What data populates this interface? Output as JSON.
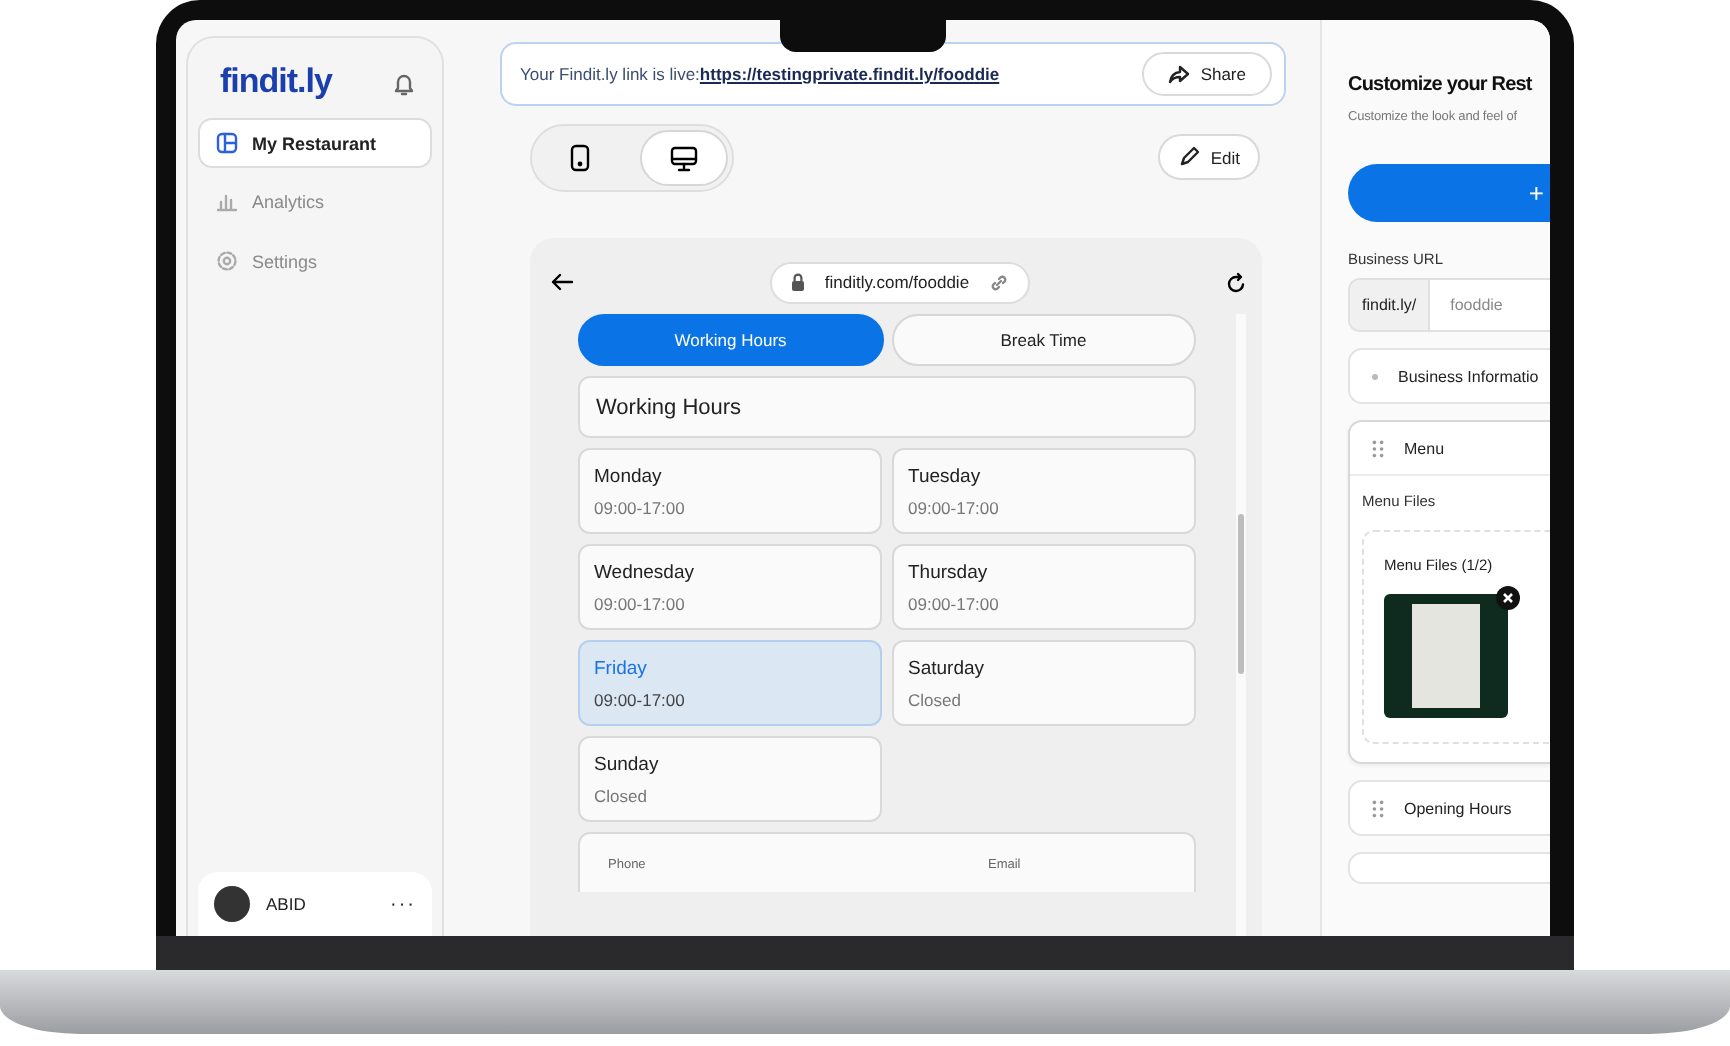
{
  "sidebar": {
    "logo": "findit.ly",
    "items": [
      {
        "label": "My Restaurant",
        "selected": true
      },
      {
        "label": "Analytics",
        "selected": false
      },
      {
        "label": "Settings",
        "selected": false
      }
    ],
    "user": {
      "name": "ABID",
      "more": "···"
    }
  },
  "banner": {
    "text": "Your Findit.ly link is live:",
    "link": "https://testingprivate.findit.ly/fooddie",
    "share": "Share"
  },
  "view_toggle": [
    {
      "kind": "mobile",
      "selected": false
    },
    {
      "kind": "desktop",
      "selected": true
    }
  ],
  "edit_button": "Edit",
  "preview": {
    "url": "finditly.com/fooddie",
    "tabs": [
      {
        "label": "Working Hours",
        "selected": true
      },
      {
        "label": "Break Time",
        "selected": false
      }
    ],
    "section_title": "Working Hours",
    "days": [
      {
        "day": "Monday",
        "hours": "09:00-17:00",
        "selected": false
      },
      {
        "day": "Tuesday",
        "hours": "09:00-17:00",
        "selected": false
      },
      {
        "day": "Wednesday",
        "hours": "09:00-17:00",
        "selected": false
      },
      {
        "day": "Thursday",
        "hours": "09:00-17:00",
        "selected": false
      },
      {
        "day": "Friday",
        "hours": "09:00-17:00",
        "selected": true
      },
      {
        "day": "Saturday",
        "hours": "Closed",
        "selected": false
      },
      {
        "day": "Sunday",
        "hours": "Closed",
        "selected": false
      }
    ],
    "contact_labels": [
      "Phone",
      "Email"
    ]
  },
  "panel": {
    "title": "Customize your Rest",
    "subtitle": "Customize the look and feel of",
    "add_button": "+",
    "url_label": "Business URL",
    "url_prefix": "findit.ly/",
    "url_value": "fooddie",
    "sections": [
      {
        "title": "Business Informatio",
        "expanded": false
      },
      {
        "title": "Menu",
        "expanded": true,
        "files_label": "Menu Files",
        "files_title": "Menu Files (1/2)"
      },
      {
        "title": "Opening Hours",
        "expanded": false
      },
      {
        "expanded": false
      }
    ]
  }
}
